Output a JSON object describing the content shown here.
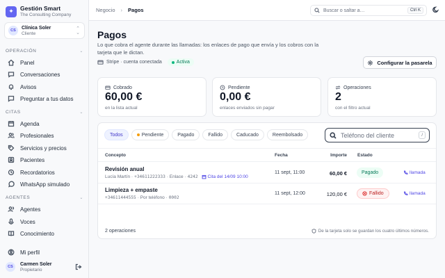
{
  "brand": {
    "logo_glyph": "✦",
    "name": "Gestión Smart",
    "subtitle": "The Consulting Company"
  },
  "workspace": {
    "initials": "CS",
    "name": "Clínica Soler",
    "role": "Cliente"
  },
  "sidebar": {
    "sections": [
      {
        "title": "Operación",
        "items": [
          {
            "label": "Panel",
            "icon": "home-icon"
          },
          {
            "label": "Conversaciones",
            "icon": "chat-icon"
          },
          {
            "label": "Avisos",
            "icon": "bell-icon"
          },
          {
            "label": "Preguntar a tus datos",
            "icon": "message-icon"
          }
        ]
      },
      {
        "title": "Citas",
        "items": [
          {
            "label": "Agenda",
            "icon": "calendar-icon"
          },
          {
            "label": "Profesionales",
            "icon": "users-icon"
          },
          {
            "label": "Servicios y precios",
            "icon": "tag-icon"
          },
          {
            "label": "Pacientes",
            "icon": "contact-icon"
          },
          {
            "label": "Recordatorios",
            "icon": "reminder-icon"
          },
          {
            "label": "WhatsApp simulado",
            "icon": "whatsapp-icon"
          }
        ]
      },
      {
        "title": "Agentes",
        "items": [
          {
            "label": "Agentes",
            "icon": "agent-icon"
          },
          {
            "label": "Voces",
            "icon": "mic-icon"
          },
          {
            "label": "Conocimiento",
            "icon": "book-icon"
          }
        ]
      }
    ],
    "profile_label": "Mi perfil"
  },
  "user": {
    "initials": "CS",
    "name": "Carmen Soler",
    "role": "Propietario"
  },
  "topbar": {
    "breadcrumb": [
      "Negocio",
      "Pagos"
    ],
    "search_placeholder": "Buscar o saltar a…",
    "search_shortcut": "Ctrl K"
  },
  "page": {
    "title": "Pagos",
    "description": "Lo que cobra el agente durante las llamadas: los enlaces de pago que envía y los cobros con la tarjeta que le dictan.",
    "connection": "Stripe · cuenta conectada",
    "connection_status": "Activa",
    "configure_button": "Configurar la pasarela"
  },
  "stats": [
    {
      "label": "Cobrado",
      "value": "60,00 €",
      "sub": "en la lista actual",
      "icon": "card-icon"
    },
    {
      "label": "Pendiente",
      "value": "0,00 €",
      "sub": "enlaces enviados sin pagar",
      "icon": "clock-icon"
    },
    {
      "label": "Operaciones",
      "value": "2",
      "sub": "con el filtro actual",
      "icon": "swap-icon"
    }
  ],
  "filters": [
    "Todos",
    "Pendiente",
    "Pagado",
    "Fallido",
    "Caducado",
    "Reembolsado"
  ],
  "active_filter": "Todos",
  "phone_search": {
    "placeholder": "Teléfono del cliente",
    "shortcut": "/"
  },
  "table": {
    "columns": [
      "Concepto",
      "Fecha",
      "Importe",
      "Estado"
    ],
    "rows": [
      {
        "title": "Revisión anual",
        "client": "Lucía Martín ·",
        "phone": "+34611222333",
        "method": "· Enlace ·",
        "ref": "4242",
        "link": "Cita del 14/09 10:00",
        "date": "11 sept, 11:00",
        "amount": "60,00 €",
        "status": "Pagado",
        "action": "llamada"
      },
      {
        "title": "Limpieza + empaste",
        "client": "",
        "phone": "+34611444555",
        "method": "· Por teléfono ·",
        "ref": "0002",
        "link": "",
        "date": "11 sept, 12:00",
        "amount": "120,00 €",
        "status": "Fallido",
        "action": "llamada"
      }
    ],
    "footer_count": "2 operaciones",
    "footer_note": "De la tarjeta solo se guardan los cuatro últimos números."
  },
  "colors": {
    "accent": "#6366f1",
    "success": "#047857",
    "danger": "#b91c1c",
    "pending": "#f59e0b"
  }
}
